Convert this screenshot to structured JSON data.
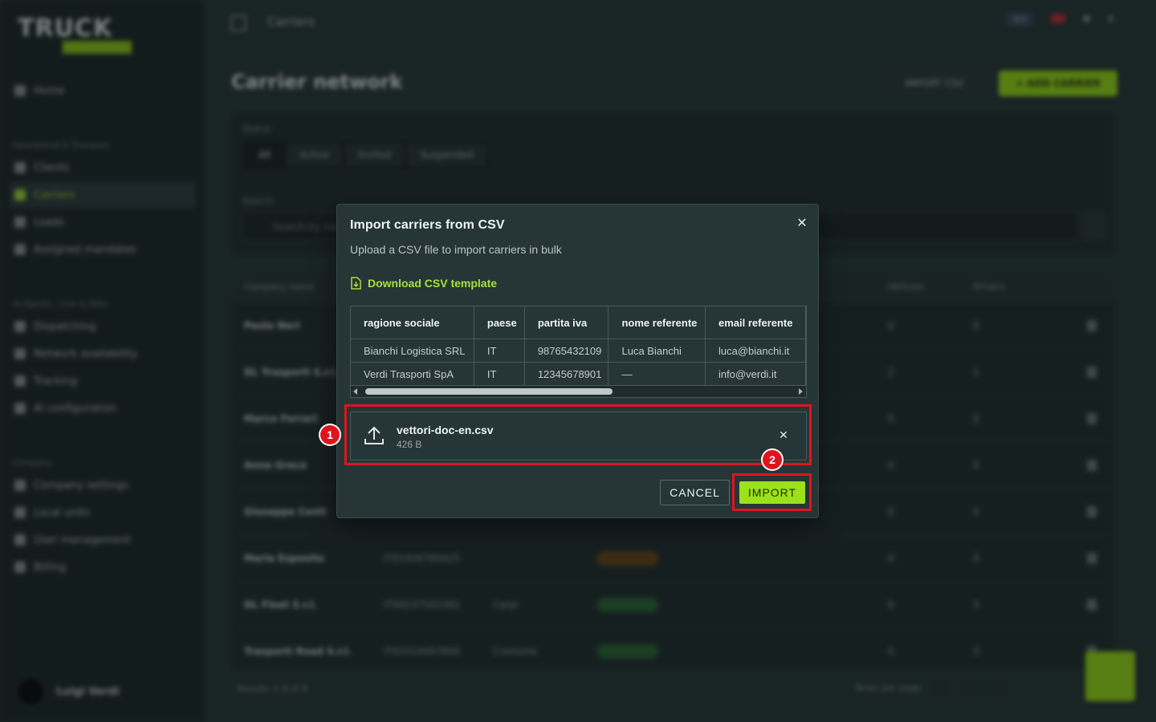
{
  "background": {
    "logo": {
      "text": "TRUCK",
      "sub": ""
    },
    "topbar_title": "Carriers",
    "page_title": "Carrier network",
    "sidebar": {
      "items": [
        {
          "label": "Home"
        },
        {
          "section": "Operational & Transport"
        },
        {
          "label": "Clients"
        },
        {
          "label": "Carriers",
          "active": true
        },
        {
          "label": "Loads"
        },
        {
          "label": "Assigned mandates"
        },
        {
          "section": "AI Agents – Live & Data"
        },
        {
          "label": "Dispatching"
        },
        {
          "label": "Network availability"
        },
        {
          "label": "Tracking"
        },
        {
          "label": "AI configuration"
        },
        {
          "section": "Company"
        },
        {
          "label": "Company settings"
        },
        {
          "label": "Local units"
        },
        {
          "label": "User management"
        },
        {
          "label": "Billing"
        }
      ]
    },
    "user": {
      "name": "Luigi Verdi"
    },
    "import_csv_button": "IMPORT CSV",
    "add_carrier_button": "+ ADD CARRIER",
    "filter_label": "Status",
    "filter_segments": [
      "All",
      "Active",
      "Invited",
      "Suspended"
    ],
    "search_label": "Search",
    "search_placeholder": "Search by name...",
    "table_columns": [
      "Company name",
      "Vehicles",
      "Drivers"
    ],
    "rows": [
      {
        "name": "Paolo Neri",
        "vat": "",
        "city": "",
        "status": "",
        "vehicles": "0",
        "drivers": "0"
      },
      {
        "name": "DL Trasporti S.r.l.",
        "vat": "",
        "city": "",
        "status": "",
        "vehicles": "2",
        "drivers": "1"
      },
      {
        "name": "Marco Ferrari",
        "vat": "",
        "city": "",
        "status": "",
        "vehicles": "0",
        "drivers": "0"
      },
      {
        "name": "Anna Greco",
        "vat": "",
        "city": "",
        "status": "",
        "vehicles": "0",
        "drivers": "0"
      },
      {
        "name": "Giuseppe Conti",
        "vat": "",
        "city": "",
        "status": "",
        "vehicles": "0",
        "drivers": "0"
      },
      {
        "name": "Maria Esposito",
        "vat": "IT01926780425",
        "city": "",
        "status": "pending",
        "vehicles": "0",
        "drivers": "0"
      },
      {
        "name": "DL Fleet S.r.l.",
        "vat": "IT09237592382",
        "city": "Carpi",
        "status": "active",
        "vehicles": "0",
        "drivers": "3"
      },
      {
        "name": "Trasporti Road S.r.l.",
        "vat": "IT03314487800",
        "city": "Cremona",
        "status": "active",
        "vehicles": "0",
        "drivers": "3"
      }
    ],
    "pager": "Results 1–8 of 8",
    "rows_per_page": "Rows per page"
  },
  "modal": {
    "title": "Import carriers from CSV",
    "subtitle": "Upload a CSV file to import carriers in bulk",
    "download_link": "Download CSV template",
    "preview": {
      "columns": [
        "ragione sociale",
        "paese",
        "partita iva",
        "nome referente",
        "email referente"
      ],
      "rows": [
        [
          "Bianchi Logistica SRL",
          "IT",
          "98765432109",
          "Luca Bianchi",
          "luca@bianchi.it"
        ],
        [
          "Verdi Trasporti SpA",
          "IT",
          "12345678901",
          "—",
          "info@verdi.it"
        ]
      ]
    },
    "file": {
      "name": "vettori-doc-en.csv",
      "size": "426 B"
    },
    "cancel_label": "CANCEL",
    "import_label": "IMPORT"
  },
  "annotations": [
    "1",
    "2"
  ],
  "colors": {
    "accent": "#9be21a",
    "annotation": "#e0141e",
    "modal_bg": "#263536"
  }
}
